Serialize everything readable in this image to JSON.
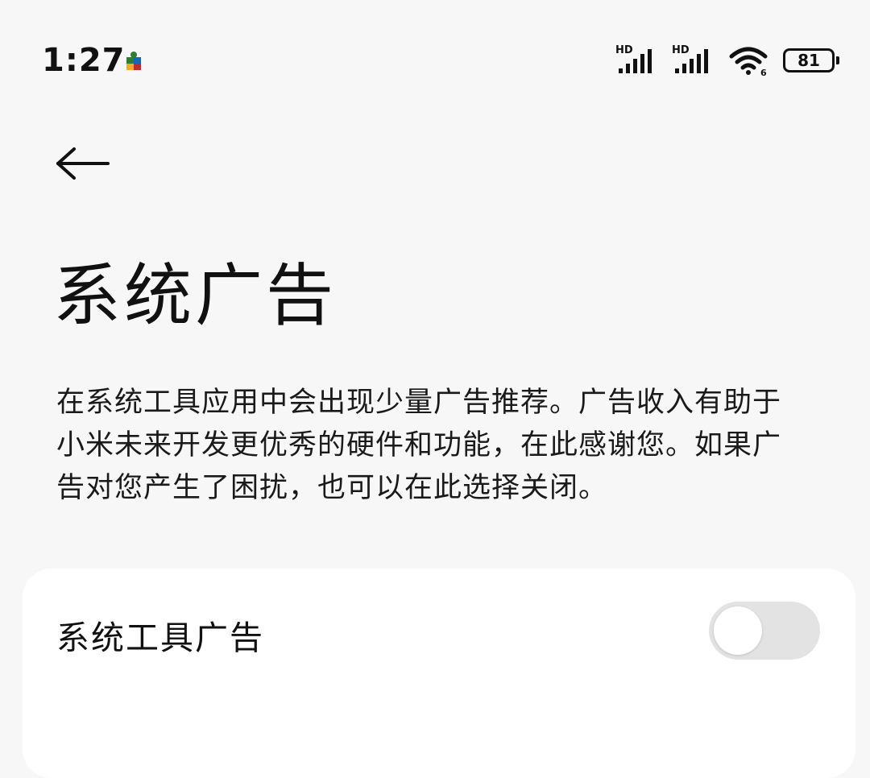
{
  "status_bar": {
    "time": "1:27",
    "battery_level": "81",
    "signal_1_label": "HD",
    "signal_2_label": "HD",
    "notification_icon": "puzzle-piece-icon",
    "wifi_icon": "wifi-icon"
  },
  "header": {
    "back_icon": "arrow-left-icon",
    "title": "系统广告"
  },
  "description": "在系统工具应用中会出现少量广告推荐。广告收入有助于小米未来开发更优秀的硬件和功能，在此感谢您。如果广告对您产生了困扰，也可以在此选择关闭。",
  "settings": [
    {
      "label": "系统工具广告",
      "enabled": false
    }
  ],
  "colors": {
    "background": "#f7f7f7",
    "card": "#ffffff",
    "toggle_off": "#e3e3e3",
    "text": "#111111"
  }
}
